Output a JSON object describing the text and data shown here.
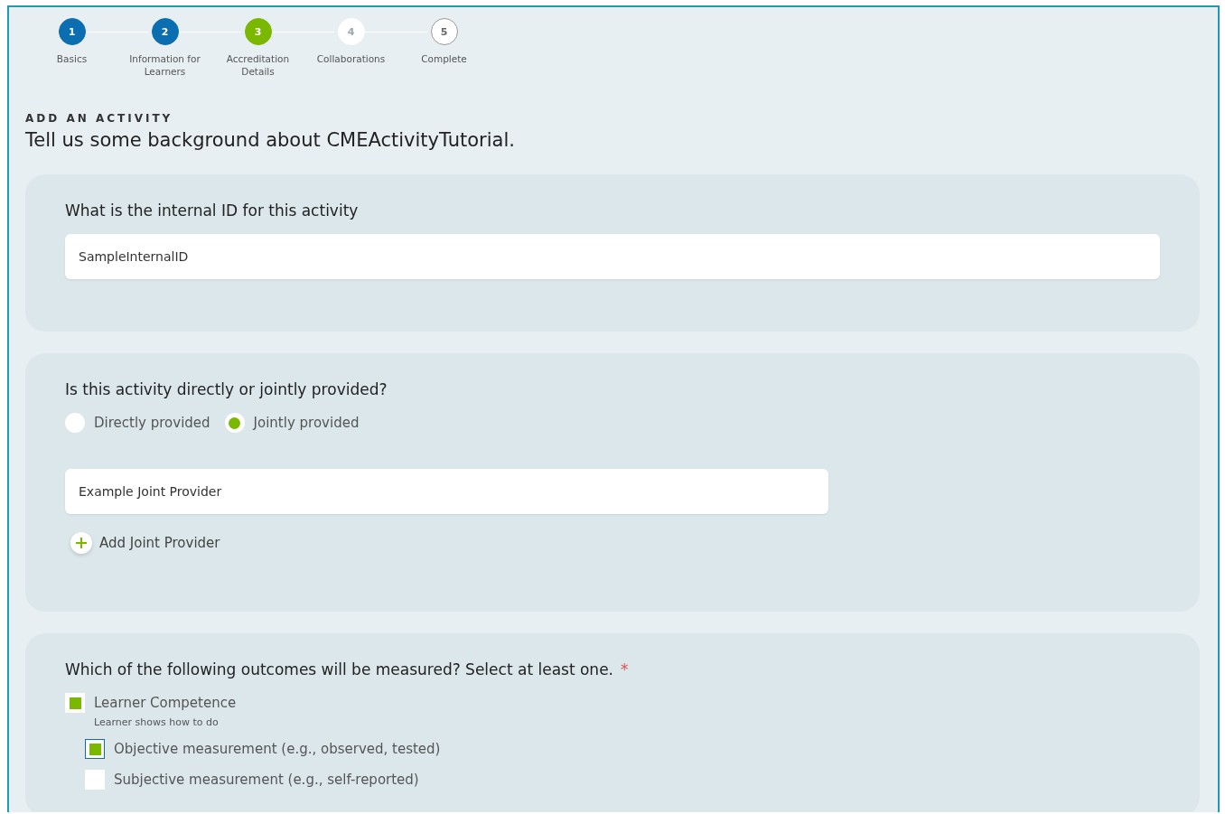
{
  "steps": [
    {
      "number": "1",
      "label": "Basics",
      "kind": "done"
    },
    {
      "number": "2",
      "label": "Information for Learners",
      "kind": "done"
    },
    {
      "number": "3",
      "label": "Accreditation Details",
      "kind": "current"
    },
    {
      "number": "4",
      "label": "Collaborations",
      "kind": "faint"
    },
    {
      "number": "5",
      "label": "Complete",
      "kind": "pending"
    }
  ],
  "eyebrow": "ADD AN ACTIVITY",
  "heading": "Tell us some background about CMEActivityTutorial.",
  "internal_id": {
    "question": "What is the internal ID for this activity",
    "value": "SampleInternalID"
  },
  "provider": {
    "question": "Is this activity directly or jointly provided?",
    "options": [
      {
        "label": "Directly provided",
        "selected": false
      },
      {
        "label": "Jointly provided",
        "selected": true
      }
    ],
    "joint_provider": {
      "value": "Example Joint Provider"
    },
    "add_label": "Add Joint Provider"
  },
  "outcomes": {
    "question": "Which of the following outcomes will be measured? Select at least one.",
    "required_mark": "*",
    "items": [
      {
        "label": "Learner Competence",
        "hint": "Learner shows how to do",
        "checked": true,
        "children": [
          {
            "label": "Objective measurement (e.g., observed, tested)",
            "checked": true,
            "focused": true
          },
          {
            "label": "Subjective measurement (e.g., self-reported)",
            "checked": false,
            "focused": false
          }
        ]
      }
    ]
  }
}
